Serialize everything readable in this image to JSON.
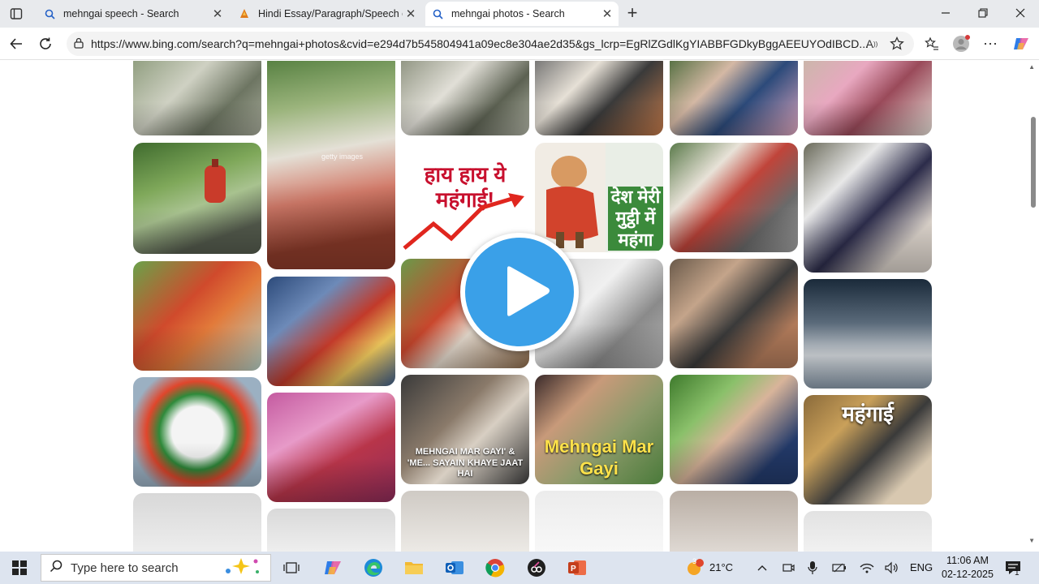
{
  "browser": {
    "tabs": [
      {
        "title": "mehngai speech - Search",
        "icon": "bing-search-icon",
        "active": false
      },
      {
        "title": "Hindi Essay/Paragraph/Speech on",
        "icon": "site-favicon-icon",
        "active": false
      },
      {
        "title": "mehngai photos - Search",
        "icon": "bing-search-icon",
        "active": true
      }
    ],
    "new_tab": "+",
    "url": "https://www.bing.com/search?q=mehngai+photos&cvid=e294d7b545804941a09ec8e304ae2d35&gs_lcrp=EgRlZGdlKgYIABBFGDkyBggAEEUYOdIBCD..."
  },
  "images": {
    "captions": [
      "getty images",
      "हाय हाय ये महंगाई!",
      "देश मेरी मुट्ठी में  महंगा",
      "MEHNGAI MAR GAYI' & 'ME... SAYAIN KHAYE JAAT HAI",
      "Mehngai Mar Gayi",
      "महंगाई"
    ]
  },
  "taskbar": {
    "search_placeholder": "Type here to search",
    "weather_temp": "21°C",
    "weather_badge": "3",
    "language": "ENG",
    "time": "11:06 AM",
    "date": "02-12-2025",
    "notification_count": "1"
  },
  "colors": {
    "accent": "#0f6cbd",
    "play_button": "#3aa0e8",
    "taskbar": "#dde4ef"
  }
}
